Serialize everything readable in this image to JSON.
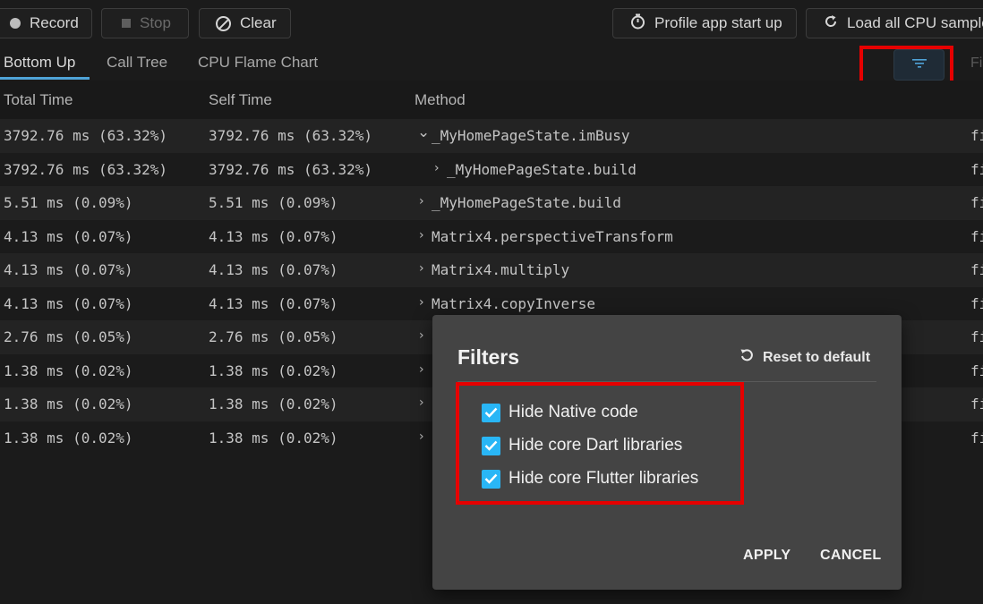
{
  "toolbar": {
    "record_label": "Record",
    "stop_label": "Stop",
    "clear_label": "Clear",
    "profile_label": "Profile app start up",
    "load_label": "Load all CPU samples"
  },
  "tabs": [
    {
      "label": "Bottom Up",
      "active": true
    },
    {
      "label": "Call Tree",
      "active": false
    },
    {
      "label": "CPU Flame Chart",
      "active": false
    }
  ],
  "filter_input_partial": "Fi",
  "table": {
    "headers": {
      "total": "Total Time",
      "self": "Self Time",
      "method": "Method"
    },
    "rows": [
      {
        "total": "3792.76 ms (63.32%)",
        "self": "3792.76 ms (63.32%)",
        "chevron": "⌄",
        "method": "_MyHomePageState.imBusy",
        "source": "fi"
      },
      {
        "total": "3792.76 ms (63.32%)",
        "self": "3792.76 ms (63.32%)",
        "chevron": "›",
        "method": "_MyHomePageState.build",
        "source": "fi"
      },
      {
        "total": "5.51 ms (0.09%)",
        "self": "5.51 ms (0.09%)",
        "chevron": "›",
        "method": "_MyHomePageState.build",
        "source": "fi"
      },
      {
        "total": "4.13 ms (0.07%)",
        "self": "4.13 ms (0.07%)",
        "chevron": "›",
        "method": "Matrix4.perspectiveTransform",
        "source": "fi"
      },
      {
        "total": "4.13 ms (0.07%)",
        "self": "4.13 ms (0.07%)",
        "chevron": "›",
        "method": "Matrix4.multiply",
        "source": "fi"
      },
      {
        "total": "4.13 ms (0.07%)",
        "self": "4.13 ms (0.07%)",
        "chevron": "›",
        "method": "Matrix4.copyInverse",
        "source": "fi"
      },
      {
        "total": "2.76 ms (0.05%)",
        "self": "2.76 ms (0.05%)",
        "chevron": "›",
        "method": "",
        "source": "fi"
      },
      {
        "total": "1.38 ms (0.02%)",
        "self": "1.38 ms (0.02%)",
        "chevron": "›",
        "method": "",
        "source": "fi"
      },
      {
        "total": "1.38 ms (0.02%)",
        "self": "1.38 ms (0.02%)",
        "chevron": "›",
        "method": "",
        "source": "fi"
      },
      {
        "total": "1.38 ms (0.02%)",
        "self": "1.38 ms (0.02%)",
        "chevron": "›",
        "method": "",
        "source": "fi"
      }
    ]
  },
  "dialog": {
    "title": "Filters",
    "reset_label": "Reset to default",
    "options": [
      {
        "label": "Hide Native code",
        "checked": true
      },
      {
        "label": "Hide core Dart libraries",
        "checked": true
      },
      {
        "label": "Hide core Flutter libraries",
        "checked": true
      }
    ],
    "apply_label": "APPLY",
    "cancel_label": "CANCEL"
  },
  "colors": {
    "accent": "#29b6f6",
    "tab_underline": "#4fa3d8",
    "highlight": "#e60000",
    "background": "#1b1b1b",
    "dialog_bg": "#444444"
  },
  "icons": {
    "record": "record-dot-icon",
    "stop": "stop-square-icon",
    "clear": "clear-ban-icon",
    "profile": "timer-icon",
    "load": "refresh-icon",
    "filter": "filter-icon",
    "reset": "reset-icon",
    "checkbox": "check-icon"
  }
}
